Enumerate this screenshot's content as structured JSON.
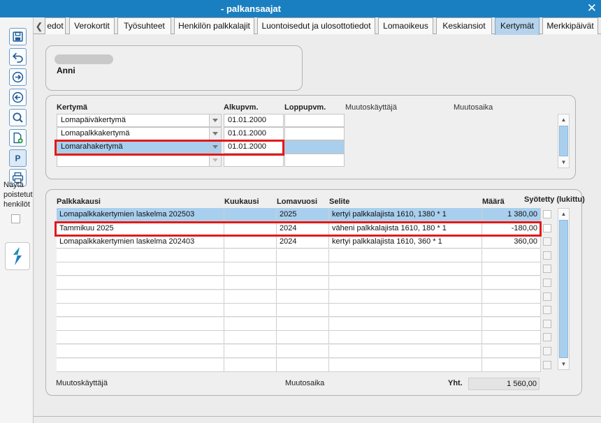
{
  "window": {
    "title": "- palkansaajat",
    "close_glyph": "✕"
  },
  "toolbar": {
    "buttons": [
      {
        "name": "save-icon"
      },
      {
        "name": "undo-icon"
      },
      {
        "name": "forward-icon"
      },
      {
        "name": "back-icon"
      },
      {
        "name": "search-icon"
      },
      {
        "name": "add-document-icon"
      },
      {
        "name": "p-button",
        "label": "P"
      },
      {
        "name": "print-icon"
      }
    ],
    "show_removed_label": "Näytä poistetut henkilöt",
    "show_removed_checked": false
  },
  "tabs": [
    {
      "label": "edot",
      "active": false
    },
    {
      "label": "Verokortit",
      "active": false
    },
    {
      "label": "Työsuhteet",
      "active": false
    },
    {
      "label": "Henkilön palkkalajit",
      "active": false
    },
    {
      "label": "Luontoisedut ja ulosottotiedot",
      "active": false
    },
    {
      "label": "Lomaoikeus",
      "active": false
    },
    {
      "label": "Keskiansiot",
      "active": false
    },
    {
      "label": "Kertymät",
      "active": true
    },
    {
      "label": "Merkkipäivät",
      "active": false
    }
  ],
  "person": {
    "name": "Anni"
  },
  "kertyma_panel": {
    "headers": {
      "kertyma": "Kertymä",
      "alkupvm": "Alkupvm.",
      "loppupvm": "Loppupvm.",
      "muutoskayttaja": "Muutoskäyttäjä",
      "muutosaika": "Muutosaika"
    },
    "rows": [
      {
        "kertyma": "Lomapäiväkertymä",
        "alkupvm": "01.01.2000",
        "loppupvm": "",
        "selected": false
      },
      {
        "kertyma": "Lomapalkkakertymä",
        "alkupvm": "01.01.2000",
        "loppupvm": "",
        "selected": false
      },
      {
        "kertyma": "Lomarahakertymä",
        "alkupvm": "01.01.2000",
        "loppupvm": "",
        "selected": true
      },
      {
        "kertyma": "",
        "alkupvm": "",
        "loppupvm": "",
        "selected": false
      }
    ]
  },
  "detail_panel": {
    "headers": {
      "palkkakausi": "Palkkakausi",
      "kuukausi": "Kuukausi",
      "lomavuosi": "Lomavuosi",
      "selite": "Selite",
      "maara": "Määrä",
      "syotetty": "Syötetty (lukittu)"
    },
    "rows": [
      {
        "palkkakausi": "Lomapalkkakertymien laskelma 202503",
        "kuukausi": "",
        "lomavuosi": "2025",
        "selite": "kertyi palkkalajista 1610, 1380 * 1",
        "maara": "1 380,00",
        "syotetty": false,
        "selected": true
      },
      {
        "palkkakausi": "Tammikuu 2025",
        "kuukausi": "",
        "lomavuosi": "2024",
        "selite": "väheni palkkalajista 1610, 180 * 1",
        "maara": "-180,00",
        "syotetty": false,
        "selected": false
      },
      {
        "palkkakausi": "Lomapalkkakertymien laskelma 202403",
        "kuukausi": "",
        "lomavuosi": "2024",
        "selite": "kertyi palkkalajista 1610, 360 * 1",
        "maara": "360,00",
        "syotetty": false,
        "selected": false
      }
    ],
    "empty_rows": 9,
    "footer": {
      "muutoskayttaja": "Muutoskäyttäjä",
      "muutosaika": "Muutosaika",
      "total_label": "Yht.",
      "total_value": "1 560,00"
    }
  },
  "colors": {
    "title_bar": "#1a7fc0",
    "selected_row": "#a9cfee",
    "active_tab": "#b6d3ec",
    "highlight": "#e11a1a"
  }
}
